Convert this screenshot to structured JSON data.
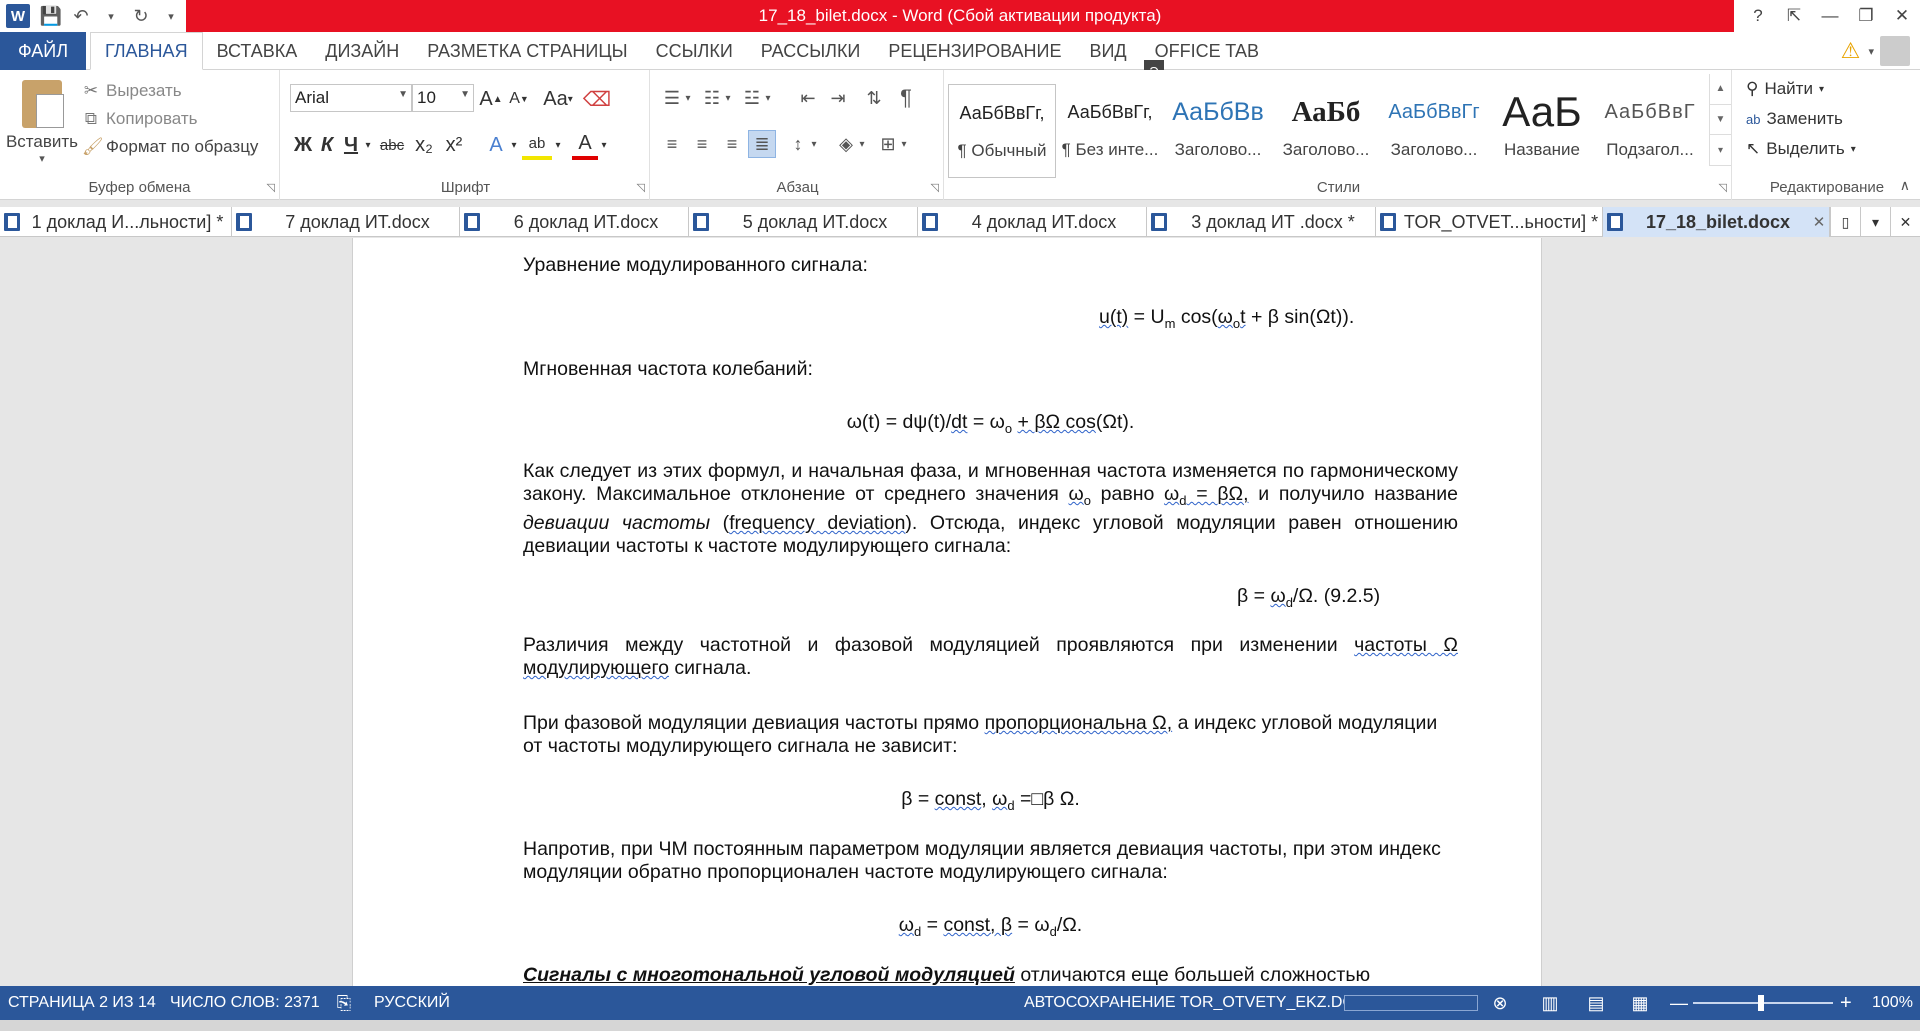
{
  "window": {
    "title": "17_18_bilet.docx -  Word (Сбой активации продукта)",
    "help": "?",
    "restore_ribbon": "⇱",
    "minimize": "—",
    "maximize": "❐",
    "close": "✕"
  },
  "qat": {
    "save": "💾",
    "undo": "↶",
    "redo": "↻",
    "customize": "▾"
  },
  "ribbon_tabs": {
    "file": "ФАЙЛ",
    "tabs": [
      "ГЛАВНАЯ",
      "ВСТАВКА",
      "ДИЗАЙН",
      "РАЗМЕТКА СТРАНИЦЫ",
      "ССЫЛКИ",
      "РАССЫЛКИ",
      "РЕЦЕНЗИРОВАНИЕ",
      "ВИД",
      "OFFICE TAB"
    ],
    "keytip": "Э"
  },
  "clipboard": {
    "paste": "Вставить",
    "cut": "Вырезать",
    "copy": "Копировать",
    "format_painter": "Формат по образцу",
    "label": "Буфер обмена"
  },
  "font": {
    "name": "Arial",
    "size": "10",
    "label": "Шрифт",
    "grow": "A",
    "shrink": "A",
    "case": "Aa",
    "bold": "Ж",
    "italic": "К",
    "underline": "Ч",
    "strike": "abc",
    "subscript": "x₂",
    "superscript": "x²",
    "effects": "A",
    "highlight": "ab",
    "color": "A"
  },
  "paragraph": {
    "label": "Абзац"
  },
  "styles": {
    "label": "Стили",
    "items": [
      {
        "sample": "АаБбВвГг,",
        "name": "¶ Обычный"
      },
      {
        "sample": "АаБбВвГг,",
        "name": "¶ Без инте..."
      },
      {
        "sample": "АаБбВв",
        "name": "Заголово..."
      },
      {
        "sample": "АаБб",
        "name": "Заголово..."
      },
      {
        "sample": "АаБбВвГг",
        "name": "Заголово..."
      },
      {
        "sample": "АаБ",
        "name": "Название"
      },
      {
        "sample": "АаБбВвГ",
        "name": "Подзагол..."
      }
    ]
  },
  "editing": {
    "find": "Найти",
    "replace": "Заменить",
    "select": "Выделить",
    "label": "Редактирование"
  },
  "doc_tabs": [
    {
      "label": "1 доклад И...льности] *",
      "active": false
    },
    {
      "label": "7 доклад ИТ.docx",
      "active": false
    },
    {
      "label": "6 доклад ИТ.docx",
      "active": false
    },
    {
      "label": "5 доклад ИТ.docx",
      "active": false
    },
    {
      "label": "4 доклад ИТ.docx",
      "active": false
    },
    {
      "label": "3 доклад ИТ .docx *",
      "active": false
    },
    {
      "label": "TOR_OTVET...ьности] *",
      "active": false
    },
    {
      "label": "17_18_bilet.docx",
      "active": true
    }
  ],
  "doc_tab_close": "✕",
  "document": {
    "p1": "Уравнение модулированного сигнала:",
    "eq1_a": "u(t)",
    "eq1_b": " = U",
    "eq1_sub": "m",
    "eq1_c": " cos(",
    "eq1_d": "ω",
    "eq1_e": "o",
    "eq1_f": "t",
    "eq1_g": " + β sin(Ωt)).",
    "p2": "Мгновенная частота колебаний:",
    "eq2_a": "ω(t) = dψ(t)/",
    "eq2_b": "dt",
    "eq2_c": " = ω",
    "eq2_d": "o",
    "eq2_e": " ",
    "eq2_f": "+ βΩ cos",
    "eq2_g": "(Ωt).",
    "p3_a": "Как следует из этих формул, и начальная фаза, и мгновенная частота изменяется по гармоническому закону. Максимальное отклонение от среднего значения ",
    "p3_b": "ω",
    "p3_c": "o",
    "p3_d": " равно ",
    "p3_e": "ω",
    "p3_f": "d",
    "p3_g": " = βΩ,",
    "p3_h": " и получило название ",
    "p3_i": "девиации частоты",
    "p3_j": " (",
    "p3_k": "frequency deviation",
    "p3_l": "). Отсюда, индекс угловой модуляции равен отношению девиации частоты к частоте модулирующего сигнала:",
    "eq3_a": "β = ",
    "eq3_b": "ω",
    "eq3_c": "d",
    "eq3_d": "/Ω. (9.2.5)",
    "p4_a": "Различия между частотной и фазовой модуляцией проявляются при изменении ",
    "p4_b": "частоты Ω модулирующего",
    "p4_c": " сигнала.",
    "p5_a": "При фазовой модуляции девиация частоты прямо ",
    "p5_b": "пропорциональна Ω,",
    "p5_c": " а индекс угловой модуляции от частоты модулирующего сигнала не зависит:",
    "eq4_a": "β = ",
    "eq4_b": "const",
    "eq4_c": ", ",
    "eq4_d": "ω",
    "eq4_e": "d",
    "eq4_f": " =",
    "eq4_g": "□",
    "eq4_h": "β Ω.",
    "p6": "Напротив, при ЧМ постоянным параметром модуляции является девиация частоты, при этом индекс модуляции обратно пропорционален частоте модулирующего сигнала:",
    "eq5_a": "ω",
    "eq5_b": "d",
    "eq5_c": " = ",
    "eq5_d": "const, β",
    "eq5_e": " = ω",
    "eq5_f": "d",
    "eq5_g": "/Ω.",
    "p7_a": "Сигналы с многотональной угловой модуляцией",
    "p7_b": " отличаются еще большей сложностью"
  },
  "status": {
    "page": "СТРАНИЦА 2 ИЗ 14",
    "words": "ЧИСЛО СЛОВ: 2371",
    "language": "РУССКИЙ",
    "autosave": "АВТОСОХРАНЕНИЕ TOR_OTVETY_EKZ.DOCX:",
    "zoom_minus": "—",
    "zoom_plus": "+",
    "zoom": "100%"
  },
  "colors": {
    "brand": "#2b579a",
    "title_red": "#e81123"
  }
}
